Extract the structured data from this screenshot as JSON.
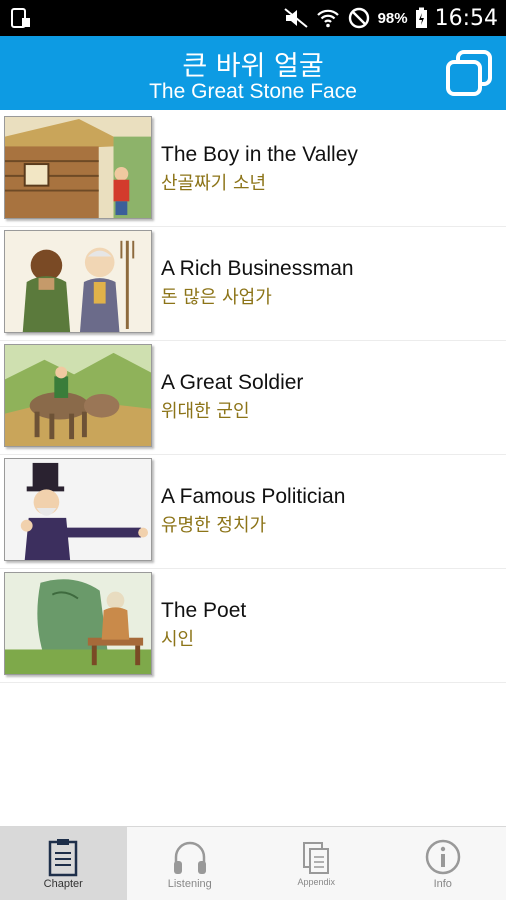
{
  "status_bar": {
    "battery": "98%",
    "time": "16:54"
  },
  "header": {
    "title_ko": "큰 바위 얼굴",
    "title_en": "The Great Stone Face"
  },
  "chapters": [
    {
      "title_en": "The Boy in the Valley",
      "title_ko": "산골짜기 소년"
    },
    {
      "title_en": "A Rich Businessman",
      "title_ko": "돈 많은 사업가"
    },
    {
      "title_en": "A Great Soldier",
      "title_ko": "위대한 군인"
    },
    {
      "title_en": "A Famous Politician",
      "title_ko": "유명한 정치가"
    },
    {
      "title_en": "The Poet",
      "title_ko": "시인"
    }
  ],
  "tabs": [
    {
      "label": "Chapter",
      "icon": "clipboard-icon",
      "active": true
    },
    {
      "label": "Listening",
      "icon": "headphones-icon",
      "active": false
    },
    {
      "label": "Appendix",
      "icon": "documents-icon",
      "active": false
    },
    {
      "label": "Info",
      "icon": "info-icon",
      "active": false
    }
  ],
  "colors": {
    "header": "#0d9be3",
    "korean_text": "#8c7418"
  }
}
